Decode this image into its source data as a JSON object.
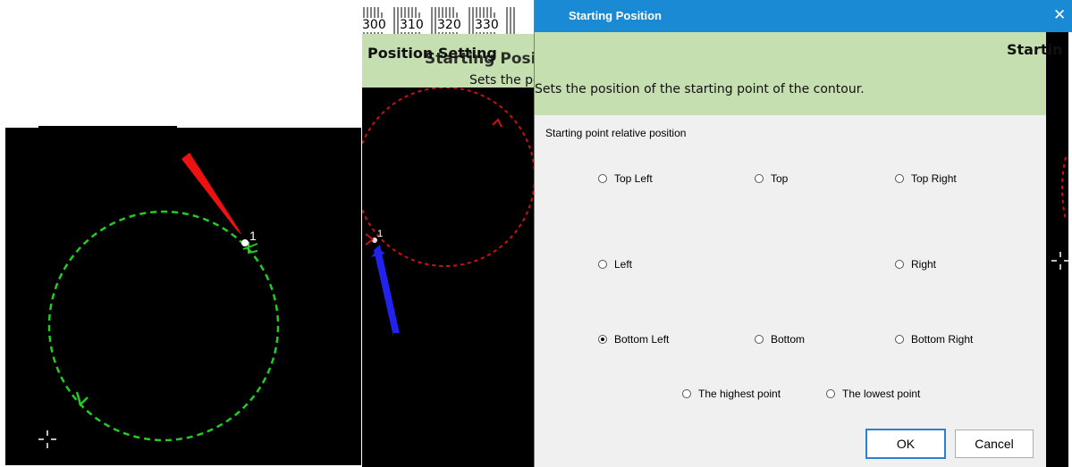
{
  "ruler": {
    "ticks": [
      "300",
      "310",
      "320",
      "330"
    ]
  },
  "position_setting": {
    "title": "Position Setting",
    "overlay_title": "Starting Position Setting",
    "description": "Sets the position of the starting point of the contour."
  },
  "left_canvas": {
    "start_label": "1"
  },
  "middle_canvas": {
    "start_label": "1"
  },
  "dialog": {
    "title": "Starting Position",
    "close_label": "✕",
    "group_label": "Starting point relative position",
    "options": {
      "top_left": "Top Left",
      "top": "Top",
      "top_right": "Top Right",
      "left": "Left",
      "right": "Right",
      "bottom_left": "Bottom Left",
      "bottom": "Bottom",
      "bottom_right": "Bottom Right",
      "highest": "The highest point",
      "lowest": "The lowest point"
    },
    "selected": "Bottom Left",
    "ok_label": "OK",
    "cancel_label": "Cancel"
  },
  "right_panel": {
    "partial_title": "Startin"
  },
  "colors": {
    "title_bar": "#1a8ad4",
    "banner": "#c5dfb1",
    "green_path": "#22cc22",
    "red_path": "#cc1111",
    "red_arrow": "#ee1111",
    "blue_arrow": "#2222ee"
  }
}
